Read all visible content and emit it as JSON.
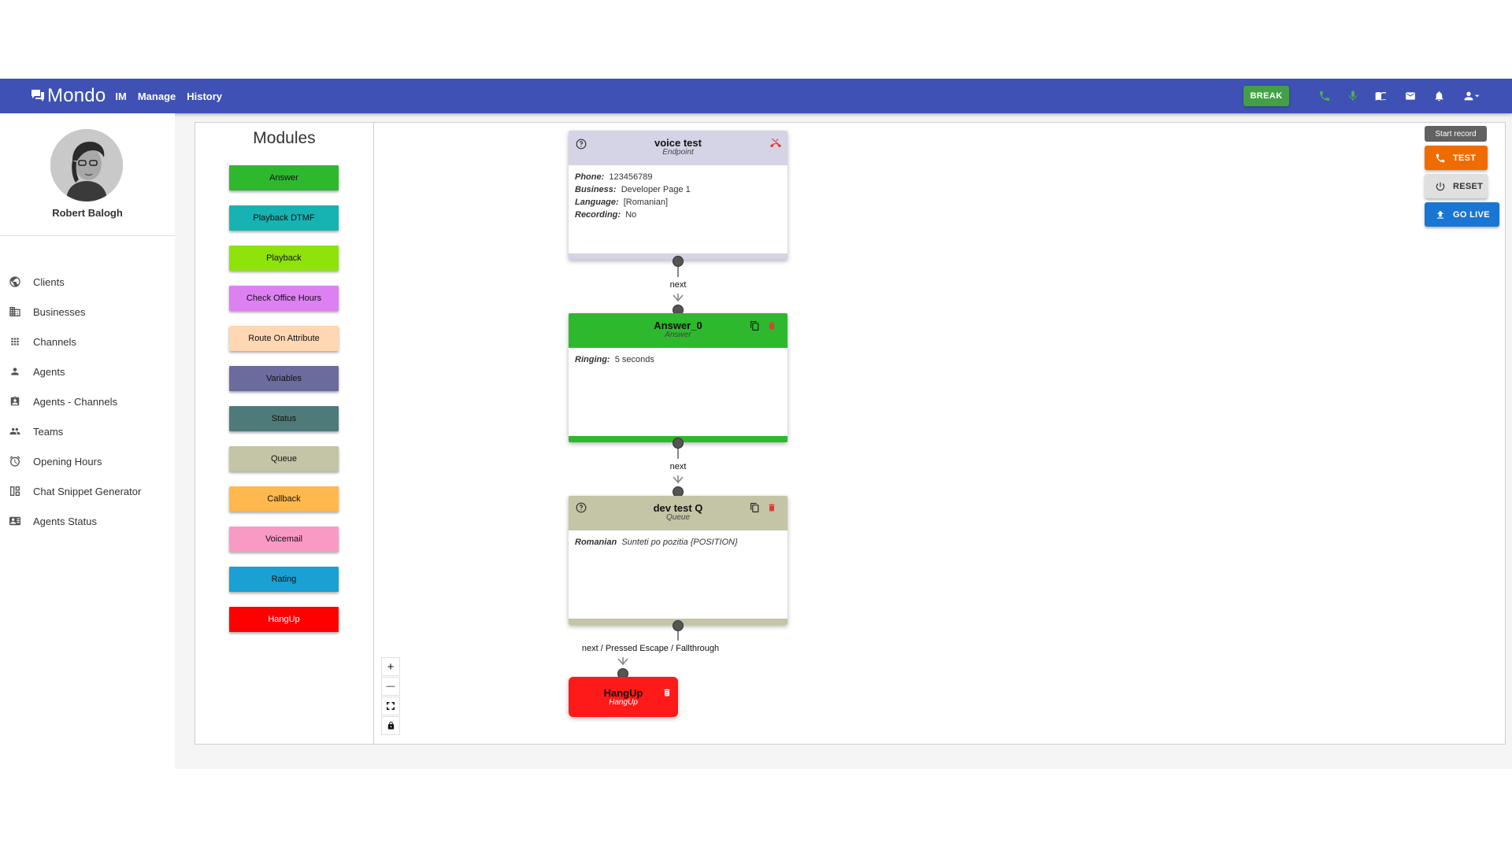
{
  "app": {
    "brand": "Mondo"
  },
  "nav": [
    {
      "label": "IM"
    },
    {
      "label": "Manage"
    },
    {
      "label": "History"
    }
  ],
  "toolbar": {
    "break_label": "BREAK"
  },
  "user": {
    "name": "Robert Balogh"
  },
  "sidebar": {
    "items": [
      {
        "label": "Clients",
        "icon": "globe-icon"
      },
      {
        "label": "Businesses",
        "icon": "business-icon"
      },
      {
        "label": "Channels",
        "icon": "apps-grid-icon"
      },
      {
        "label": "Agents",
        "icon": "person-icon"
      },
      {
        "label": "Agents - Channels",
        "icon": "contact-badge-icon"
      },
      {
        "label": "Teams",
        "icon": "people-icon"
      },
      {
        "label": "Opening Hours",
        "icon": "alarm-icon"
      },
      {
        "label": "Chat Snippet Generator",
        "icon": "code-icon"
      },
      {
        "label": "Agents Status",
        "icon": "contact-card-icon"
      }
    ]
  },
  "modules": {
    "title": "Modules",
    "items": [
      {
        "label": "Answer",
        "color": "#2eb82e",
        "text_color": "#111"
      },
      {
        "label": "Playback DTMF",
        "color": "#17b3b3",
        "text_color": "#111"
      },
      {
        "label": "Playback",
        "color": "#8fe30a",
        "text_color": "#111"
      },
      {
        "label": "Check Office Hours",
        "color": "#dd80f2",
        "text_color": "#111"
      },
      {
        "label": "Route On Attribute",
        "color": "#ffd7b2",
        "text_color": "#111"
      },
      {
        "label": "Variables",
        "color": "#6b6b9e",
        "text_color": "#111"
      },
      {
        "label": "Status",
        "color": "#4f7a7a",
        "text_color": "#111"
      },
      {
        "label": "Queue",
        "color": "#c4c4a6",
        "text_color": "#111"
      },
      {
        "label": "Callback",
        "color": "#ffb84d",
        "text_color": "#111"
      },
      {
        "label": "Voicemail",
        "color": "#f99ac4",
        "text_color": "#111"
      },
      {
        "label": "Rating",
        "color": "#1aa0d3",
        "text_color": "#111"
      },
      {
        "label": "HangUp",
        "color": "#ff0000",
        "text_color": "#ffffff"
      }
    ]
  },
  "nodes": {
    "endpoint": {
      "title": "voice test",
      "subtitle": "Endpoint",
      "color": "#d4d4e6",
      "fields": [
        {
          "k": "Phone:",
          "v": "123456789"
        },
        {
          "k": "Business:",
          "v": "Developer Page 1"
        },
        {
          "k": "Language:",
          "v": "[Romanian]"
        },
        {
          "k": "Recording:",
          "v": "No"
        }
      ]
    },
    "answer": {
      "title": "Answer_0",
      "subtitle": "Answer",
      "color": "#2eb82e",
      "fields": [
        {
          "k": "Ringing:",
          "v": "5 seconds"
        }
      ]
    },
    "queue": {
      "title": "dev test Q",
      "subtitle": "Queue",
      "color": "#c4c4a6",
      "fields": [
        {
          "k": "Romanian",
          "v": "Sunteti po pozitia {POSITION}"
        }
      ]
    },
    "hangup": {
      "title": "HangUp",
      "subtitle": "HangUp",
      "color": "#ff1a1a"
    }
  },
  "edges": [
    {
      "label": "next"
    },
    {
      "label": "next"
    },
    {
      "label": "next / Pressed Escape / Fallthrough"
    }
  ],
  "zoom_controls": [
    {
      "label": "+",
      "name": "zoom-in-button"
    },
    {
      "label": "—",
      "name": "zoom-out-button"
    }
  ],
  "actions": {
    "tooltip": "Start record",
    "test_label": "TEST",
    "reset_label": "RESET",
    "golive_label": "GO LIVE",
    "test_color": "#ef6c00",
    "reset_color": "#e0e0e0",
    "golive_color": "#1976d2"
  }
}
